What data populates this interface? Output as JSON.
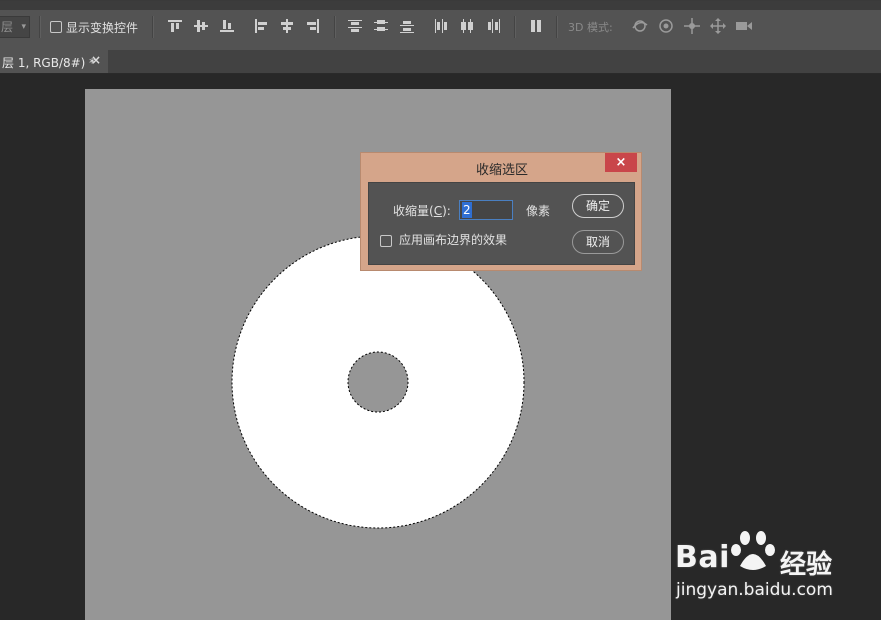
{
  "options_bar": {
    "layer_dropdown_label": "层",
    "show_transform_label": "显示变换控件",
    "mode_3d_label": "3D 模式:",
    "align_icons": [
      "align-top-icon",
      "align-vcenter-icon",
      "align-bottom-icon",
      "align-left-icon",
      "align-hcenter-icon",
      "align-right-icon"
    ],
    "distribute_icons": [
      "dist-top-icon",
      "dist-vcenter-icon",
      "dist-bottom-icon",
      "dist-left-icon",
      "dist-hcenter-icon",
      "dist-right-icon"
    ],
    "auto_align_icon": "auto-align-icon",
    "mode_3d_icons": [
      "orbit-3d-icon",
      "roll-3d-icon",
      "pan-3d-icon",
      "slide-3d-icon",
      "camera-3d-icon"
    ]
  },
  "document_tab": {
    "title": "层 1, RGB/8#) *",
    "close": "×"
  },
  "dialog": {
    "title": "收缩选区",
    "close": "×",
    "amount_label_prefix": "收缩量(",
    "amount_label_key": "C",
    "amount_label_suffix": "):",
    "amount_value": "2",
    "unit": "像素",
    "canvas_bounds_label": "应用画布边界的效果",
    "canvas_bounds_checked": false,
    "ok_label": "确定",
    "cancel_label": "取消"
  },
  "watermark": {
    "brand_left": "Bai",
    "brand_right": "经验",
    "url": "jingyan.baidu.com"
  },
  "colors": {
    "panel": "#535353",
    "workspace": "#282828",
    "canvas": "#969696",
    "dialog_frame": "#d5a58a",
    "close_red": "#c9464a",
    "selection_fill": "#ffffff"
  }
}
